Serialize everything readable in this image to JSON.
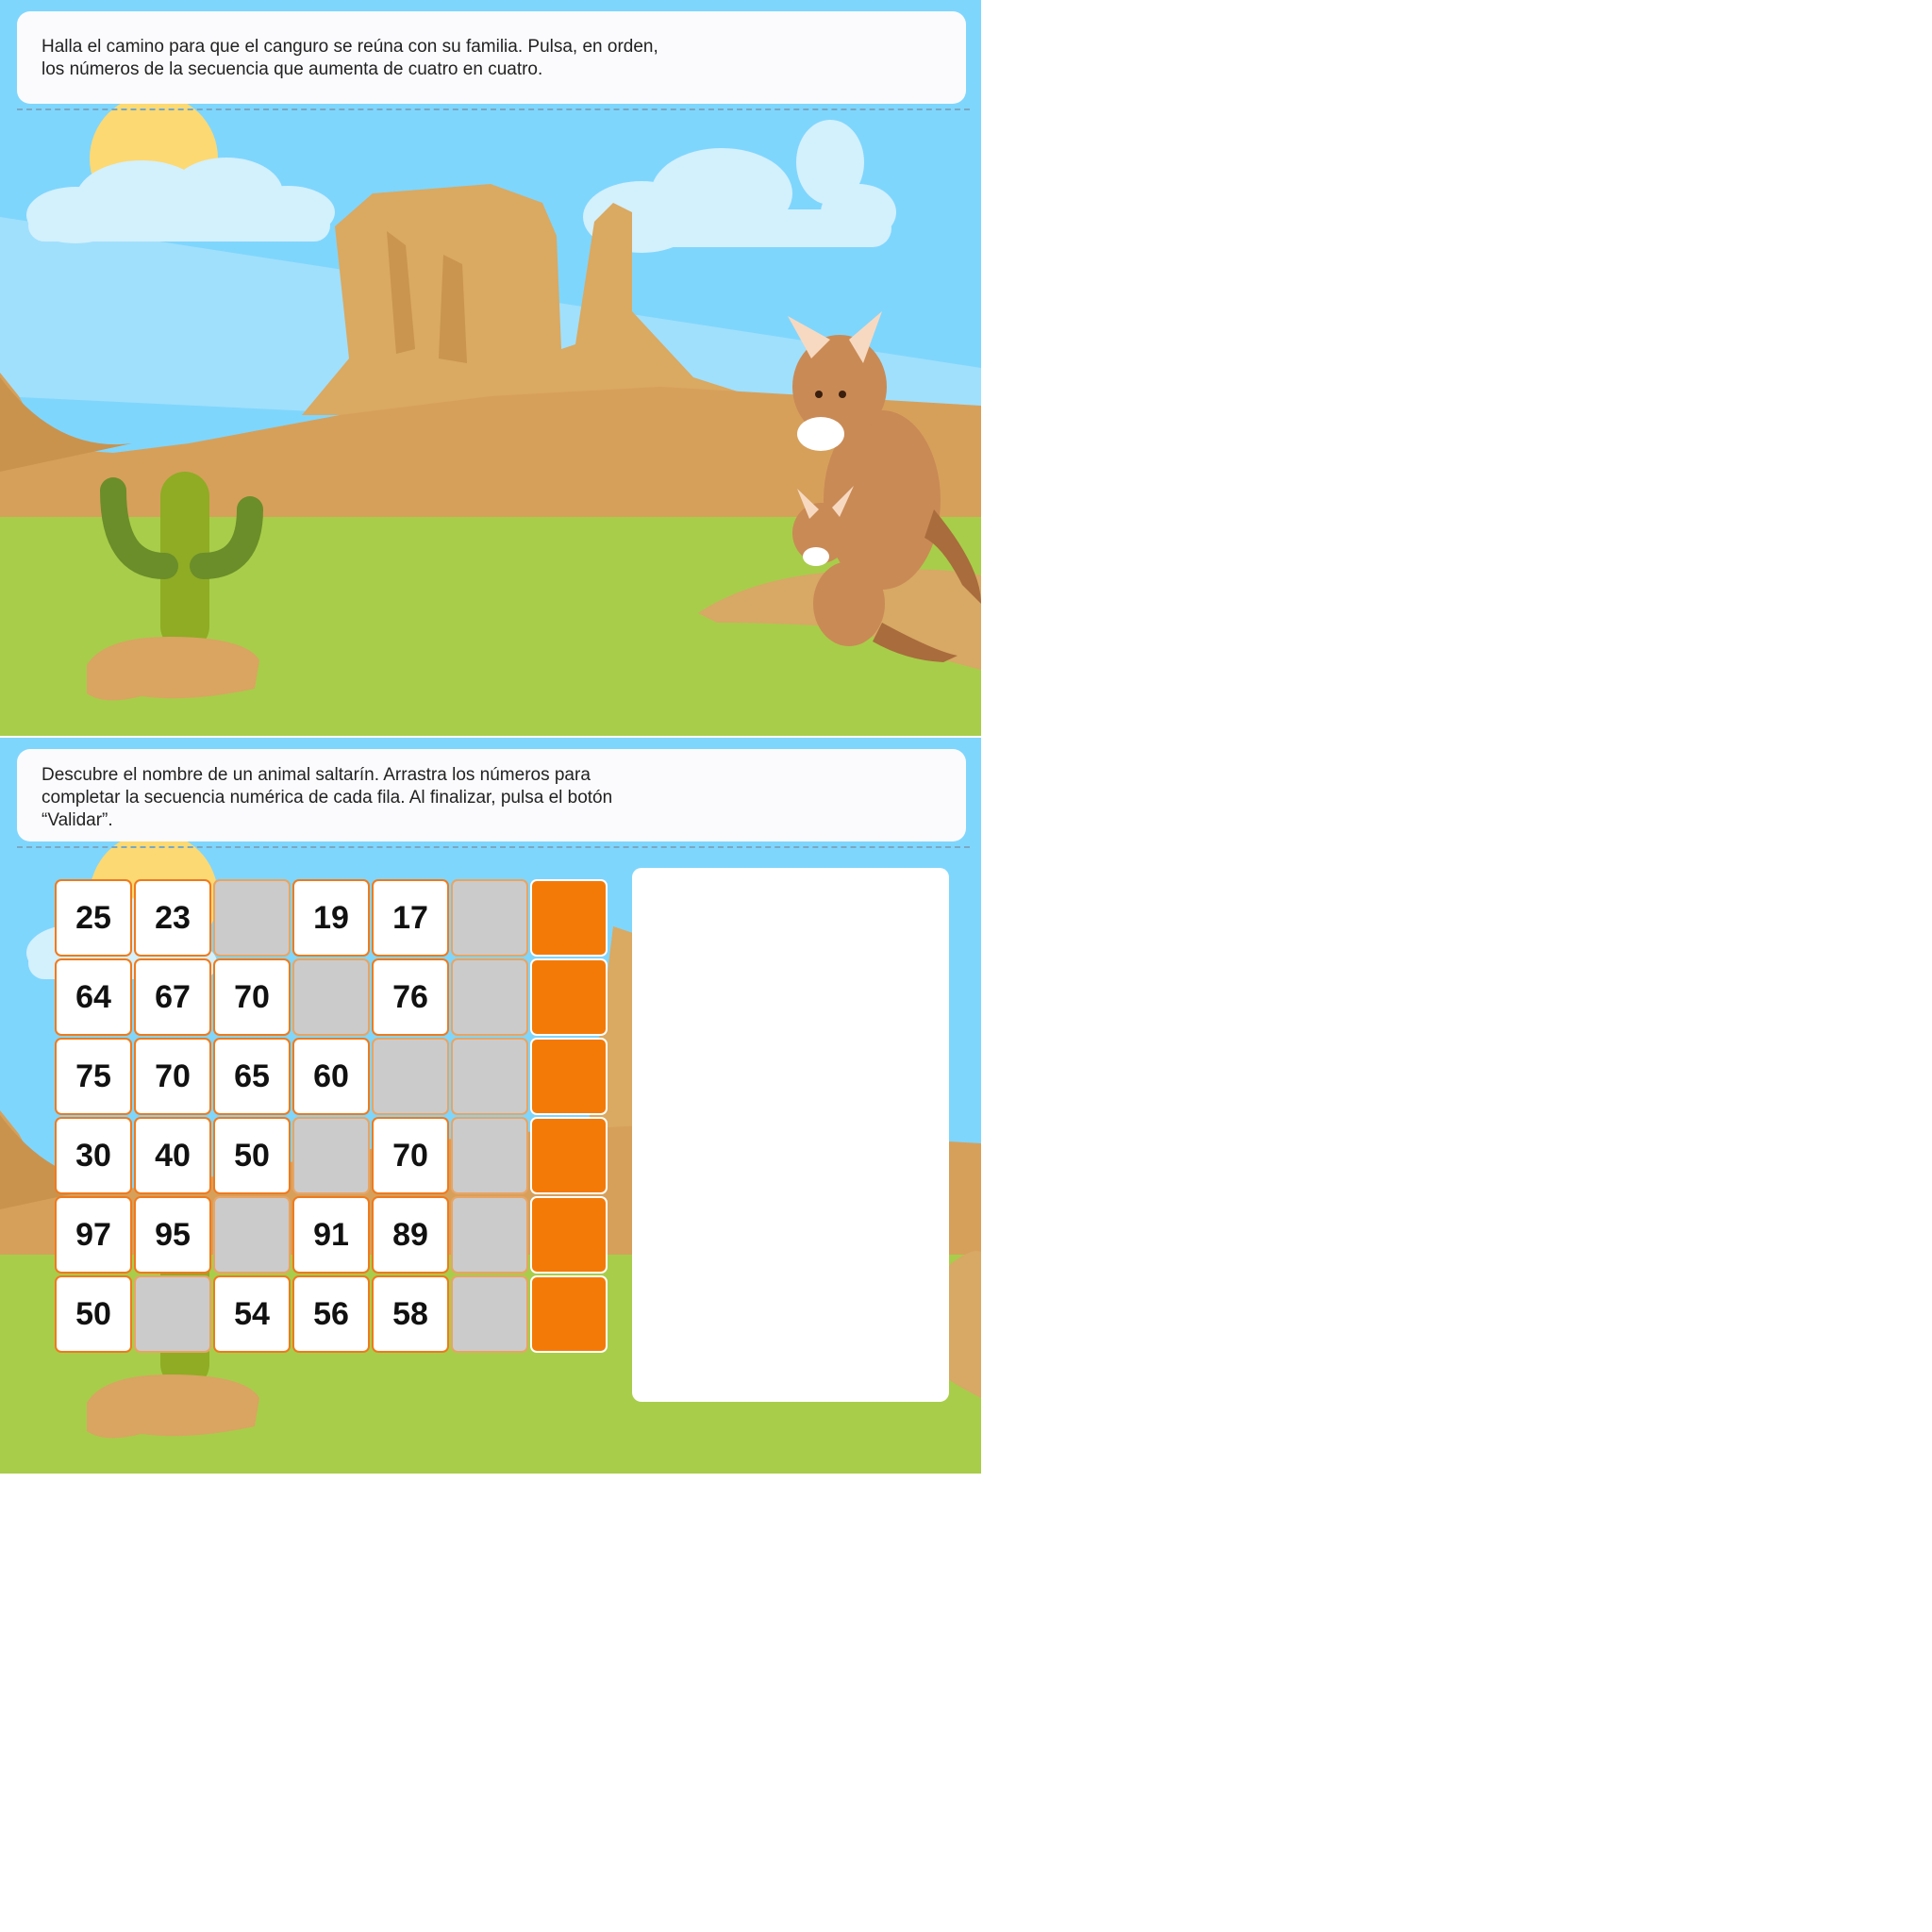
{
  "activity1": {
    "instruction": [
      "Halla el camino para que el canguro se reúna con su familia. Pulsa, en orden,",
      "los números de la secuencia que aumenta de cuatro en cuatro."
    ]
  },
  "activity2": {
    "instruction": [
      "Descubre el nombre de un animal saltarín. Arrastra los números para",
      "completar la secuencia numérica de cada fila. Al finalizar, pulsa el botón",
      "“Validar”."
    ],
    "grid": [
      [
        "25",
        "23",
        "",
        "19",
        "17"
      ],
      [
        "64",
        "67",
        "70",
        "",
        "76"
      ],
      [
        "75",
        "70",
        "65",
        "60",
        ""
      ],
      [
        "30",
        "40",
        "50",
        "",
        "70"
      ],
      [
        "97",
        "95",
        "",
        "91",
        "89"
      ],
      [
        "50",
        "",
        "54",
        "56",
        "58"
      ]
    ]
  },
  "colors": {
    "sky": "#7fd6fd",
    "grass": "#a8cd4a",
    "rock": "#d9a560",
    "cell_border": "#f07a1c",
    "answer_cell": "#f47a08",
    "empty_cell": "#cbcbcb"
  }
}
